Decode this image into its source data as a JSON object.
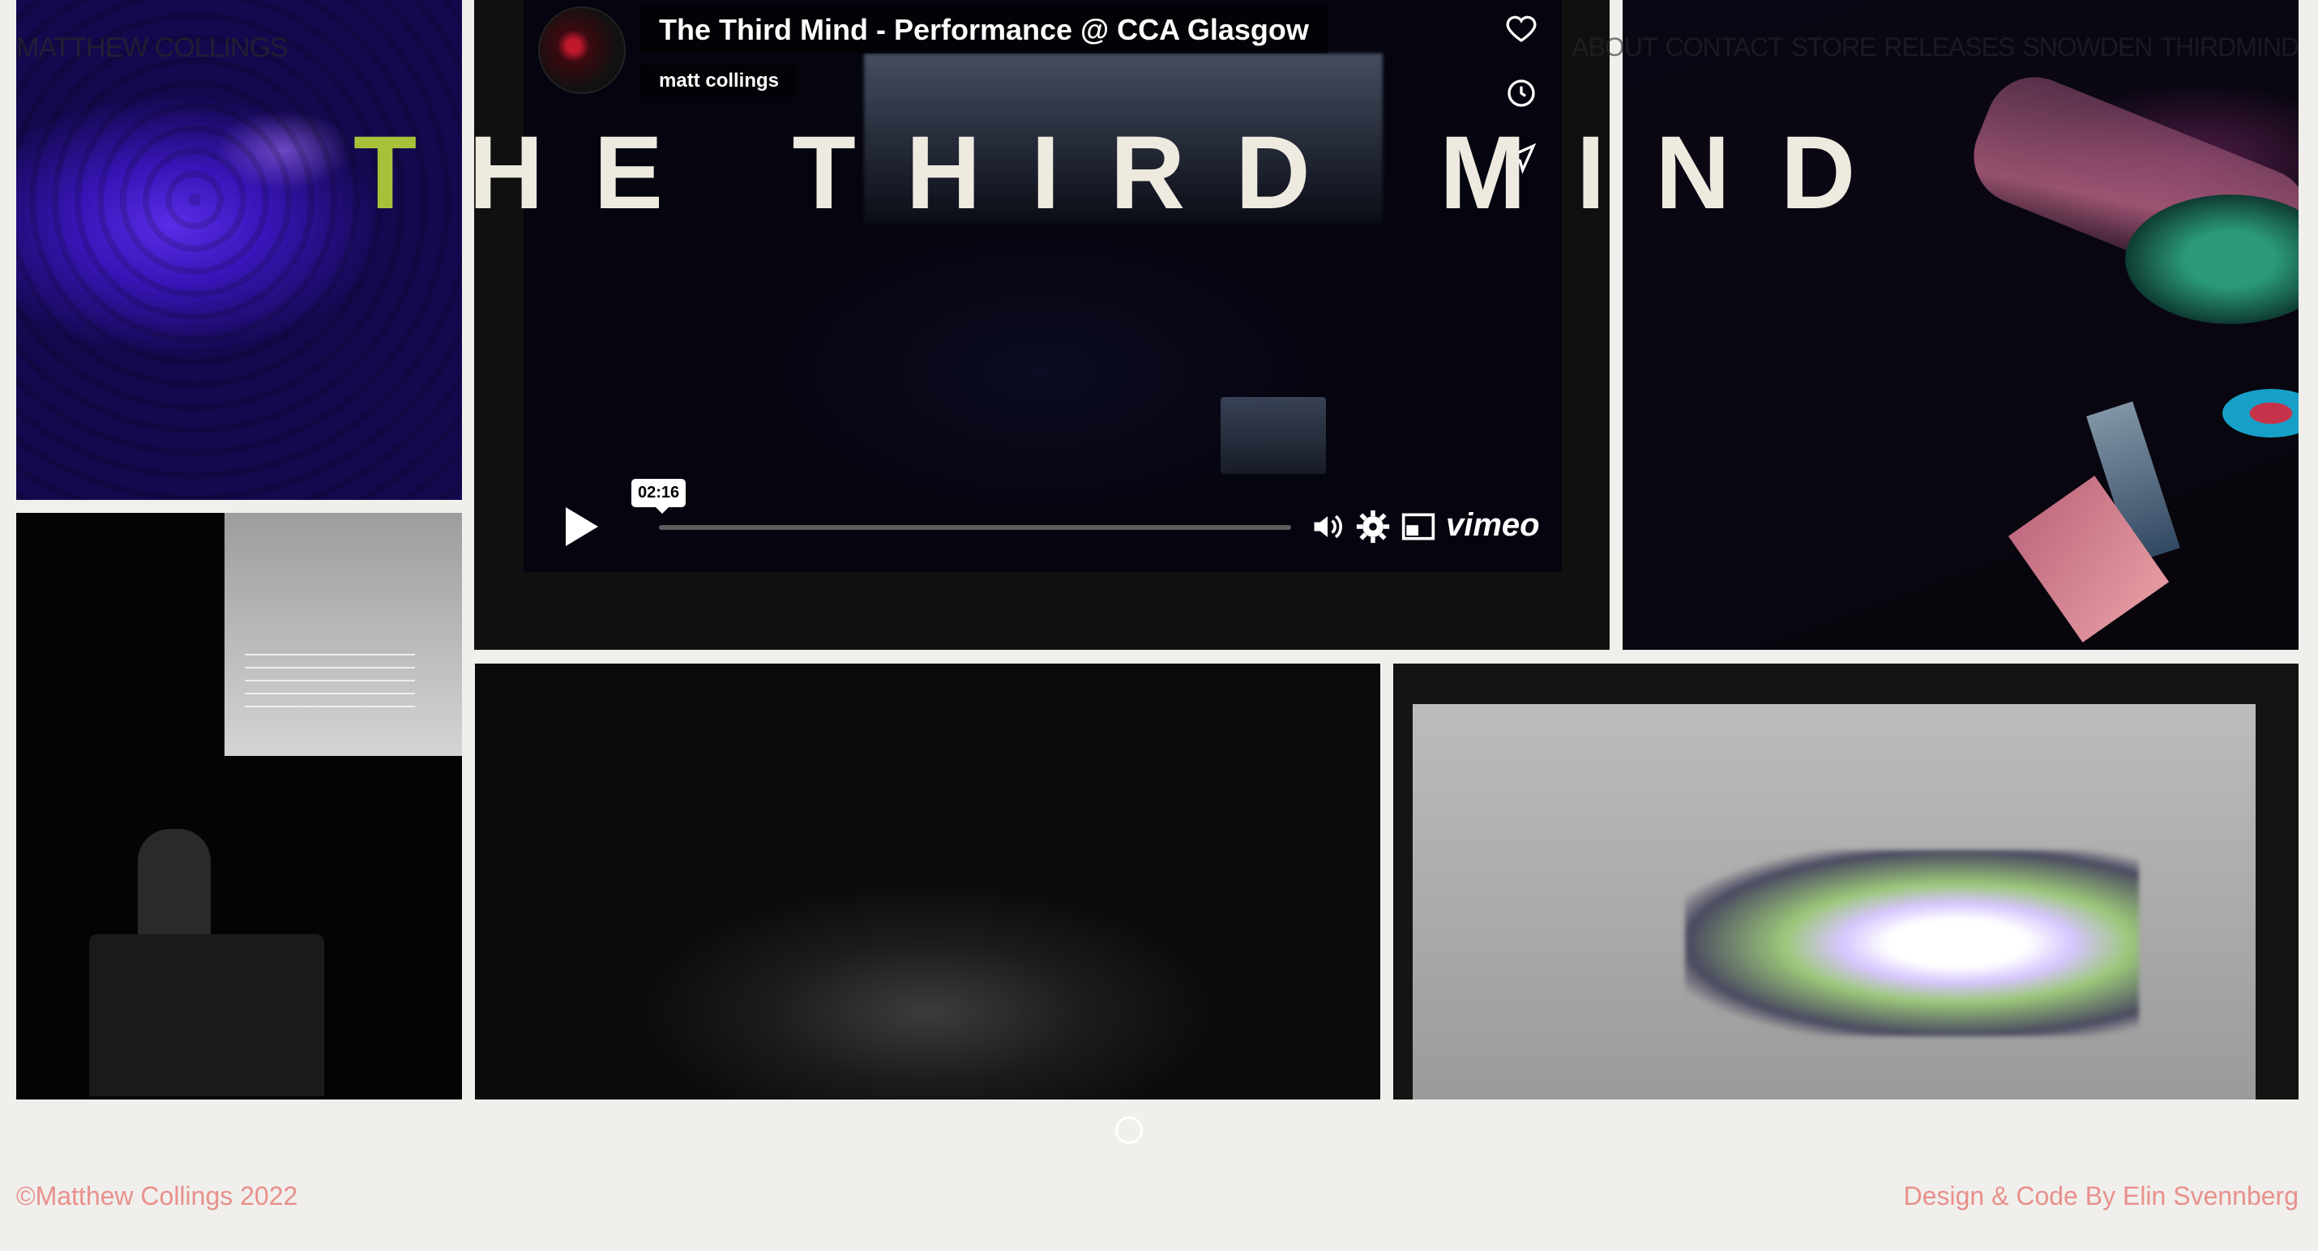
{
  "site": {
    "logo": "MATTHEW COLLINGS"
  },
  "nav": {
    "items": [
      "ABOUT",
      "CONTACT",
      "STORE",
      "RELEASES",
      "SNOWDEN",
      "THIRDMIND"
    ]
  },
  "hero": {
    "title_accent": "T",
    "title_rest": "HE THIRD MIND"
  },
  "video": {
    "title": "The Third Mind - Performance @ CCA Glasgow",
    "author": "matt collings",
    "time": "02:16",
    "progress": 0.0,
    "provider": "vimeo",
    "icons": [
      "heart-icon",
      "clock-icon",
      "paper-plane-icon",
      "play-icon",
      "volume-icon",
      "settings-icon",
      "pip-icon"
    ]
  },
  "footer": {
    "left": "©Matthew Collings 2022",
    "right": "Design & Code By Elin Svennberg"
  },
  "colors": {
    "background": "#f0efec",
    "accent": "#a7c23a",
    "footer_text": "#e8908c"
  }
}
